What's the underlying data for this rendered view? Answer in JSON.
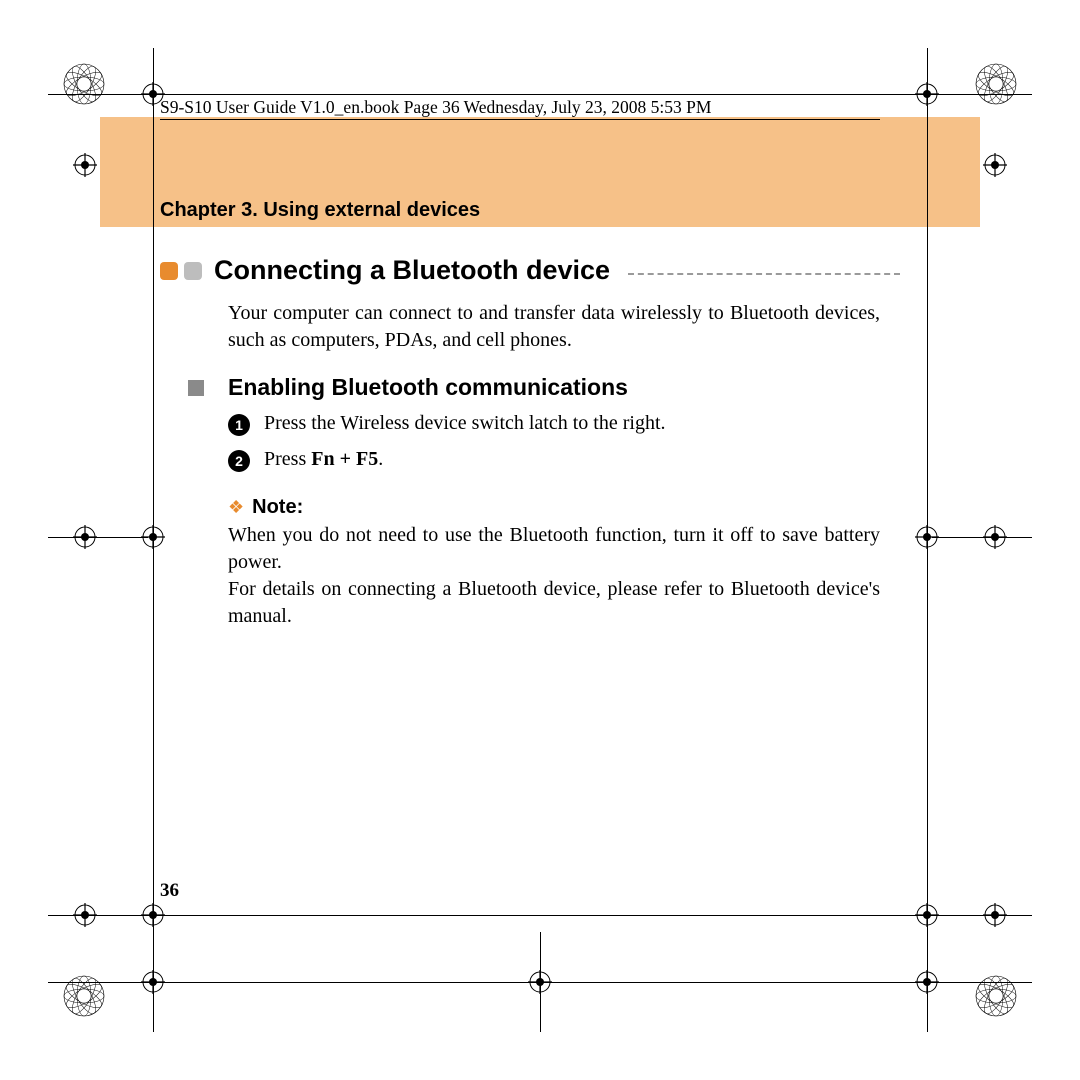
{
  "header_line": "S9-S10 User Guide V1.0_en.book  Page 36  Wednesday, July 23, 2008  5:53 PM",
  "chapter_title": "Chapter 3. Using external devices",
  "section_title": "Connecting a Bluetooth device",
  "intro_text": "Your computer can connect to and transfer data wirelessly to Bluetooth devices, such as computers, PDAs, and cell phones.",
  "subsection_title": "Enabling Bluetooth communications",
  "steps": {
    "s1_num": "1",
    "s1_text": "Press the Wireless device switch latch to the right.",
    "s2_num": "2",
    "s2_prefix": "Press ",
    "s2_bold": "Fn + F5",
    "s2_suffix": "."
  },
  "note_label": "Note:",
  "note_body": "When you do not need to use the Bluetooth function, turn it off to save battery power.\nFor details on connecting a Bluetooth device, please refer to Bluetooth device's manual.",
  "page_number": "36"
}
